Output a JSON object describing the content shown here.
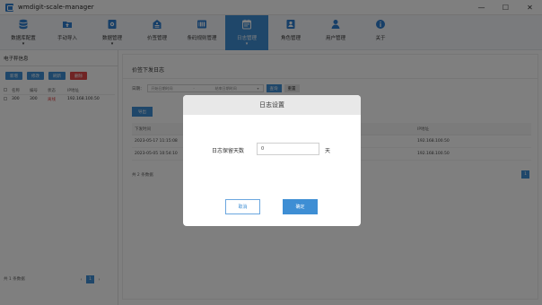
{
  "window": {
    "title": "wmdigit-scale-manager",
    "controls": [
      "—",
      "☐",
      "✕"
    ]
  },
  "toolbar": {
    "items": [
      {
        "label": "数据库配置",
        "icon": "database-icon",
        "has_dropdown": true,
        "active": false
      },
      {
        "label": "手动导入",
        "icon": "folder-upload-icon",
        "has_dropdown": false,
        "active": false
      },
      {
        "label": "数据管理",
        "icon": "gear-doc-icon",
        "has_dropdown": true,
        "active": false
      },
      {
        "label": "价签管理",
        "icon": "tag-icon",
        "has_dropdown": false,
        "active": false
      },
      {
        "label": "条码规则管理",
        "icon": "barcode-icon",
        "has_dropdown": false,
        "active": false
      },
      {
        "label": "日志管理",
        "icon": "calendar-log-icon",
        "has_dropdown": true,
        "active": true
      },
      {
        "label": "角色管理",
        "icon": "role-icon",
        "has_dropdown": false,
        "active": false
      },
      {
        "label": "用户管理",
        "icon": "user-icon",
        "has_dropdown": false,
        "active": false
      },
      {
        "label": "关于",
        "icon": "info-icon",
        "has_dropdown": false,
        "active": false
      }
    ]
  },
  "left_panel": {
    "title": "电子秤信息",
    "buttons": [
      {
        "label": "新增",
        "color": "#3e8ed4"
      },
      {
        "label": "修改",
        "color": "#3e8ed4"
      },
      {
        "label": "刷新",
        "color": "#3e8ed4"
      },
      {
        "label": "删除",
        "color": "#e04848"
      }
    ],
    "columns": [
      "",
      "名称",
      "编号",
      "状态",
      "IP地址"
    ],
    "rows": [
      {
        "check": "",
        "name": "300",
        "code": "300",
        "status": "离线",
        "ip": "192.168.100.50"
      }
    ],
    "footer_text": "共 1 条数据",
    "pager": {
      "prev": "‹",
      "current": "1",
      "next": "›"
    }
  },
  "main": {
    "title": "价签下发日志",
    "filter": {
      "label": "日期：",
      "start_placeholder": "开始日期时间",
      "separator": "-",
      "end_placeholder": "结束日期时间",
      "search_label": "查询",
      "reset_label": "重置"
    },
    "export_label": "导出",
    "columns": [
      "下发时间",
      "IP地址"
    ],
    "rows": [
      {
        "time": "2023-05-17 11:15:08",
        "ip": "192.168.100.50"
      },
      {
        "time": "2023-05-05 10:54:10",
        "ip": "192.168.100.50"
      }
    ],
    "footer_text": "共 2 条数据",
    "page": "1"
  },
  "modal": {
    "title": "日志设置",
    "field_label": "日志保留天数",
    "field_value": "0",
    "field_unit": "天",
    "cancel_label": "取消",
    "ok_label": "确定"
  }
}
